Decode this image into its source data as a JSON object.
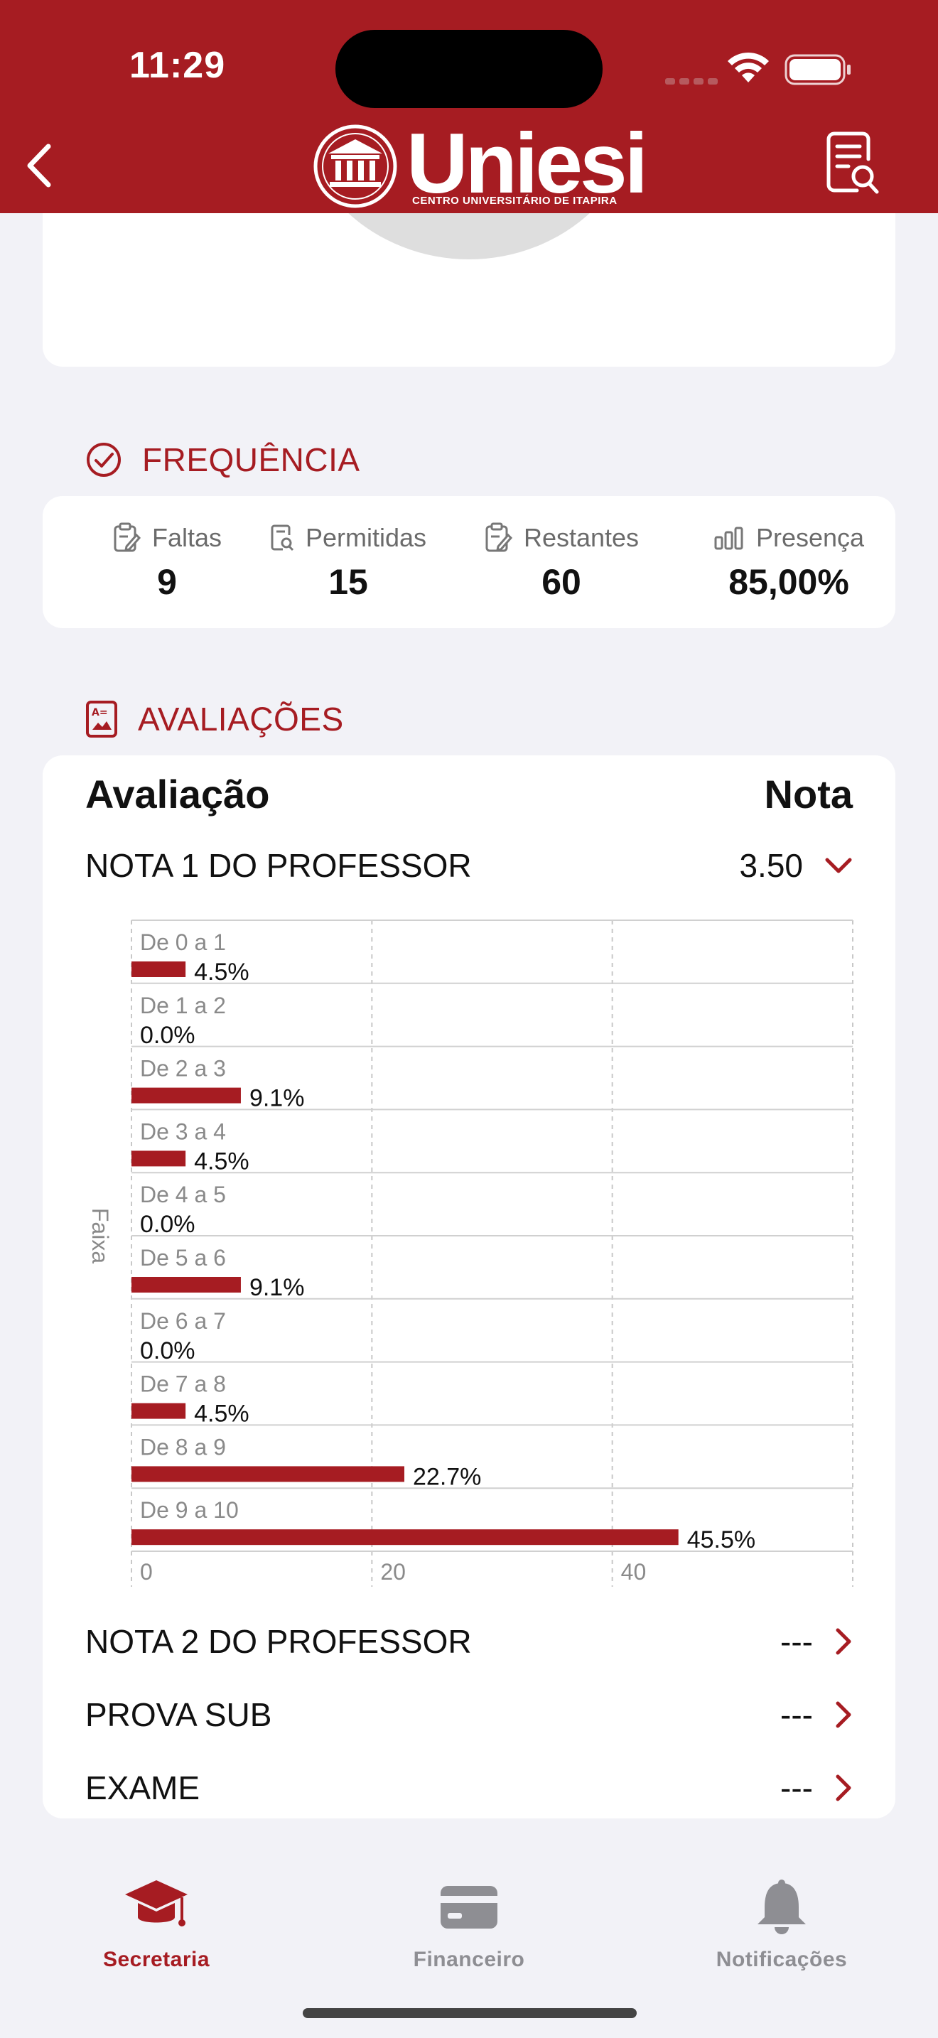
{
  "status_bar": {
    "time": "11:29"
  },
  "header": {
    "logo_text": "Uniesi",
    "logo_subtitle": "CENTRO UNIVERSITÁRIO DE ITAPIRA"
  },
  "frequencia": {
    "title": "FREQUÊNCIA",
    "stats": [
      {
        "label": "Faltas",
        "value": "9"
      },
      {
        "label": "Permitidas",
        "value": "15"
      },
      {
        "label": "Restantes",
        "value": "60"
      },
      {
        "label": "Presença",
        "value": "85,00%"
      }
    ]
  },
  "avaliacoes": {
    "title": "AVALIAÇÕES",
    "col_avaliacao": "Avaliação",
    "col_nota": "Nota",
    "rows": [
      {
        "name": "NOTA 1 DO PROFESSOR",
        "score": "3.50"
      },
      {
        "name": "NOTA 2 DO PROFESSOR",
        "score": "---"
      },
      {
        "name": "PROVA SUB",
        "score": "---"
      },
      {
        "name": "EXAME",
        "score": "---"
      }
    ]
  },
  "chart_data": {
    "type": "bar",
    "orientation": "horizontal",
    "ylabel": "Faixa",
    "categories": [
      "De 0 a 1",
      "De 1 a 2",
      "De 2 a 3",
      "De 3 a 4",
      "De 4 a 5",
      "De 5 a 6",
      "De 6 a 7",
      "De 7 a 8",
      "De 8 a 9",
      "De 9 a 10"
    ],
    "values": [
      4.5,
      0.0,
      9.1,
      4.5,
      0.0,
      9.1,
      0.0,
      4.5,
      22.7,
      45.5
    ],
    "value_labels": [
      "4.5%",
      "0.0%",
      "9.1%",
      "4.5%",
      "0.0%",
      "9.1%",
      "0.0%",
      "4.5%",
      "22.7%",
      "45.5%"
    ],
    "xticks": [
      "0",
      "20",
      "40"
    ],
    "xlim": [
      0,
      60
    ],
    "grid": true,
    "bar_color": "#a61c22"
  },
  "tabbar": {
    "tabs": [
      {
        "label": "Secretaria",
        "active": true
      },
      {
        "label": "Financeiro",
        "active": false
      },
      {
        "label": "Notificações",
        "active": false
      }
    ]
  },
  "colors": {
    "accent": "#a61c22",
    "background": "#f2f2f7",
    "inactive": "#8e8e93"
  }
}
